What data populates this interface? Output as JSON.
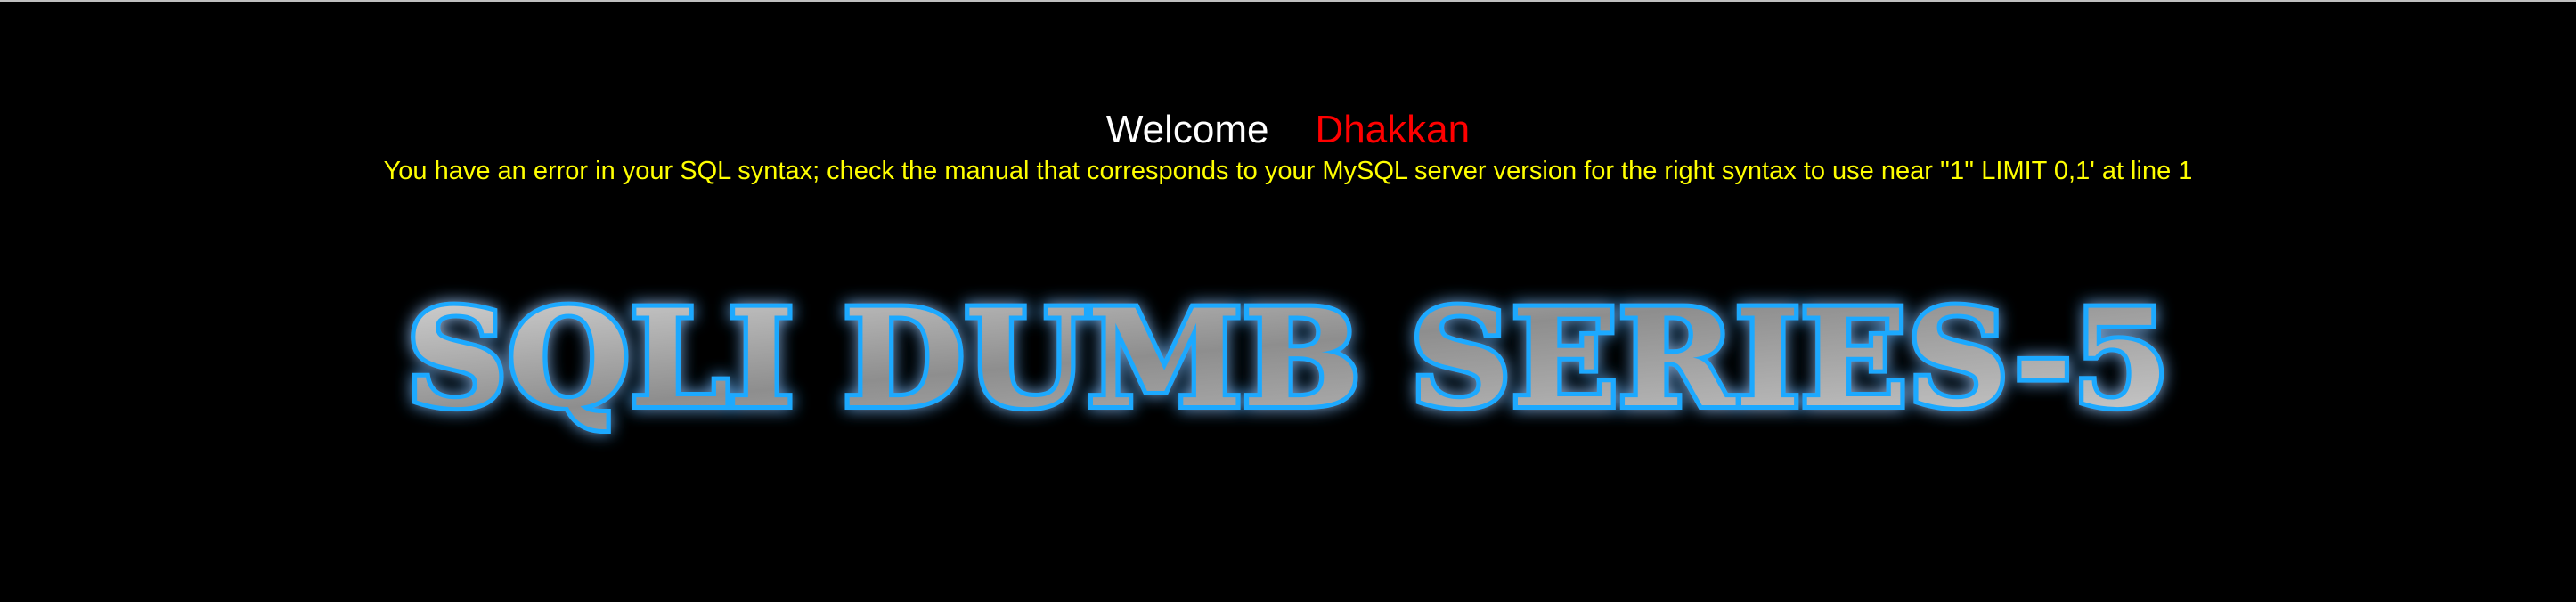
{
  "header": {
    "welcome_label": "Welcome",
    "user_name": "Dhakkan"
  },
  "message": {
    "error_text": "You have an error in your SQL syntax; check the manual that corresponds to your MySQL server version for the right syntax to use near ''1'' LIMIT 0,1' at line 1"
  },
  "logo": {
    "text": "SQLI DUMB SERIES-5"
  },
  "colors": {
    "background": "#000000",
    "welcome": "#ffffff",
    "user_name": "#ff0000",
    "error": "#ffff00",
    "glow": "#1fa9ff",
    "metal": "#9a9a9a"
  }
}
